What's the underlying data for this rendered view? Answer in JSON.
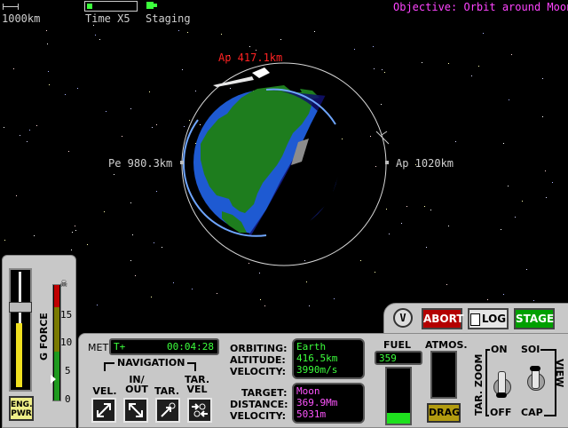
{
  "top_bar": {
    "scale_label": "1000km",
    "time_label": "Time X5",
    "staging_label": "Staging",
    "objective": "Objective: Orbit around Moon"
  },
  "orbit": {
    "ap_primary": "Ap 417.1km",
    "pe_label": "Pe 980.3km",
    "ap_secondary": "Ap 1020km"
  },
  "left_panel": {
    "g_force_label": "G FORCE",
    "ticks": [
      "15",
      "10",
      "5",
      "0"
    ],
    "eng_pwr_label": "ENG. PWR"
  },
  "controls": {
    "abort": "ABORT",
    "log": "LOG",
    "stage": "STAGE"
  },
  "met": {
    "label": "MET",
    "prefix": "T+",
    "time": "00:04:28"
  },
  "navigation": {
    "title": "NAVIGATION",
    "buttons": [
      {
        "label": "VEL.",
        "icon": "velocity-icon"
      },
      {
        "label": "IN/ OUT",
        "icon": "in-out-icon"
      },
      {
        "label": "TAR.",
        "icon": "target-icon"
      },
      {
        "label": "TAR. VEL",
        "icon": "target-velocity-icon"
      }
    ]
  },
  "readouts": {
    "orbiting_label": "ORBITING:",
    "altitude_label": "ALTITUDE:",
    "velocity_label": "VELOCITY:",
    "orbiting": "Earth",
    "altitude": "416.5km",
    "velocity": "3990m/s",
    "target_label": "TARGET:",
    "distance_label": "DISTANCE:",
    "tvelocity_label": "VELOCITY:",
    "target": "Moon",
    "distance": "369.9Mm",
    "tvelocity": "5031m"
  },
  "fuel": {
    "label": "FUEL",
    "value": "359",
    "level": 0.2
  },
  "atmos": {
    "label": "ATMOS.",
    "drag_label": "DRAG"
  },
  "switches": {
    "on_label": "ON",
    "off_label": "OFF",
    "tar_zoom_label": "TAR. ZOOM",
    "soi_label": "SOI",
    "cap_label": "CAP",
    "view_label": "VIEW"
  },
  "colors": {
    "objective": "#ff44ff",
    "apoapsis_primary": "#ff2222",
    "lcd_green": "#3cff3c",
    "lcd_magenta": "#ff55ff",
    "abort_red": "#b40000",
    "stage_green": "#00a000",
    "earth_ocean": "#1e5ad2",
    "earth_land": "#1e7d1e"
  }
}
